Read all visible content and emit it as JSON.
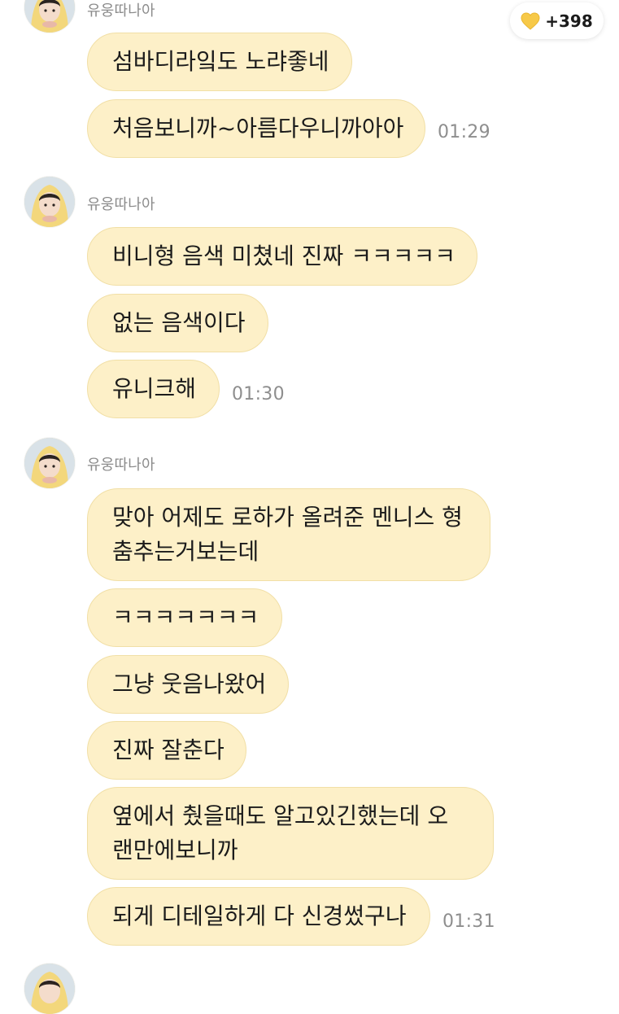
{
  "reaction_badge": {
    "icon": "yellow-heart-icon",
    "count": "+398",
    "heart_color": "#f7c948"
  },
  "colors": {
    "bubble_bg": "#fdf0c8",
    "bubble_border": "#f1dfa6",
    "sender_text": "#8b8b8b",
    "time_text": "#8e8e8e"
  },
  "messages": [
    {
      "group": 1,
      "sender": "유웅따나아",
      "lines": [
        "섬바디라잌도 노랴좋네",
        "처음보니까~아름다우니까아아"
      ],
      "time": "01:29"
    },
    {
      "group": 2,
      "sender": "유웅따나아",
      "lines": [
        "비니형 음색 미쳤네 진짜 ㅋㅋㅋㅋㅋ",
        "없는 음색이다",
        "유니크해"
      ],
      "time": "01:30"
    },
    {
      "group": 3,
      "sender": "유웅따나아",
      "lines": [
        "맞아 어제도 로하가 올려준 멘니스 형 춤추는거보는데",
        "ㅋㅋㅋㅋㅋㅋㅋ",
        "그냥 웃음나왔어",
        "진짜 잘춘다",
        "옆에서 췄을때도 알고있긴했는데 오랜만에보니까",
        "되게 디테일하게 다 신경썼구나"
      ],
      "time": "01:31"
    }
  ]
}
